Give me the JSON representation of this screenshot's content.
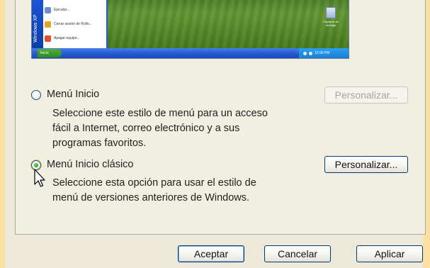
{
  "preview": {
    "brand": "Windows XP",
    "menu_items": [
      "Ejecutar...",
      "Cerrar sesión de Rollo...",
      "Apagar equipo..."
    ],
    "start_label": "Inicio",
    "tray_time": "12:00 PM",
    "recycle_label": "Papelera de reciclaje"
  },
  "options": {
    "start": {
      "label": "Menú Inicio",
      "description_lines": [
        "Seleccione este estilo de menú para un acceso",
        "fácil a Internet, correo electrónico y a sus",
        "programas favoritos."
      ],
      "customize_label": "Personalizar...",
      "selected": false
    },
    "classic": {
      "label": "Menú Inicio clásico",
      "description_lines": [
        "Seleccione esta opción para usar el estilo de",
        "menú de versiones anteriores de Windows."
      ],
      "customize_label": "Personalizar...",
      "selected": true
    }
  },
  "buttons": {
    "ok": "Aceptar",
    "cancel": "Cancelar",
    "apply": "Aplicar"
  },
  "colors": {
    "frame": "#fbdfa3",
    "dialog": "#ece9d8",
    "button_border": "#003c74",
    "radio_selected": "#2aa11a"
  }
}
